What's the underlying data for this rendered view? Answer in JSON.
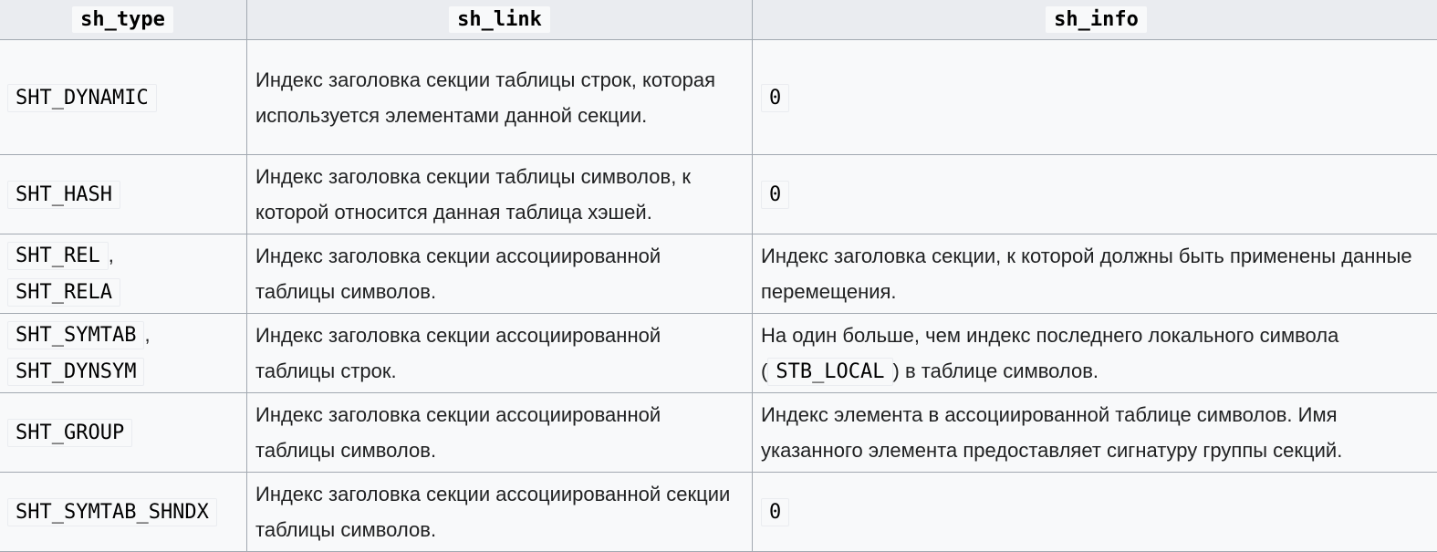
{
  "table": {
    "headers": [
      "sh_type",
      "sh_link",
      "sh_info"
    ],
    "rows": [
      {
        "type": [
          "SHT_DYNAMIC"
        ],
        "link": "Индекс заголовка секции таблицы строк, которая используется элементами данной секции.",
        "info_code": "0"
      },
      {
        "type": [
          "SHT_HASH"
        ],
        "link": "Индекс заголовка секции таблицы символов, к которой относится данная таблица хэшей.",
        "info_code": "0"
      },
      {
        "type": [
          "SHT_REL",
          "SHT_RELA"
        ],
        "link": "Индекс заголовка секции ассоциированной таблицы символов.",
        "info": "Индекс заголовка секции, к которой должны быть применены данные перемещения."
      },
      {
        "type": [
          "SHT_SYMTAB",
          "SHT_DYNSYM"
        ],
        "link": "Индекс заголовка секции ассоциированной таблицы строк.",
        "info_before": "На один больше, чем индекс последнего локального символа (",
        "info_code": "STB_LOCAL",
        "info_after": ") в таблице символов."
      },
      {
        "type": [
          "SHT_GROUP"
        ],
        "link": "Индекс заголовка секции ассоциированной таблицы символов.",
        "info": "Индекс элемента в ассоциированной таблице символов. Имя указанного элемента предоставляет сигнатуру группы секций."
      },
      {
        "type": [
          "SHT_SYMTAB_SHNDX"
        ],
        "link": "Индекс заголовка секции ассоциированной секции таблицы символов.",
        "info_code": "0"
      }
    ],
    "separator": ","
  }
}
